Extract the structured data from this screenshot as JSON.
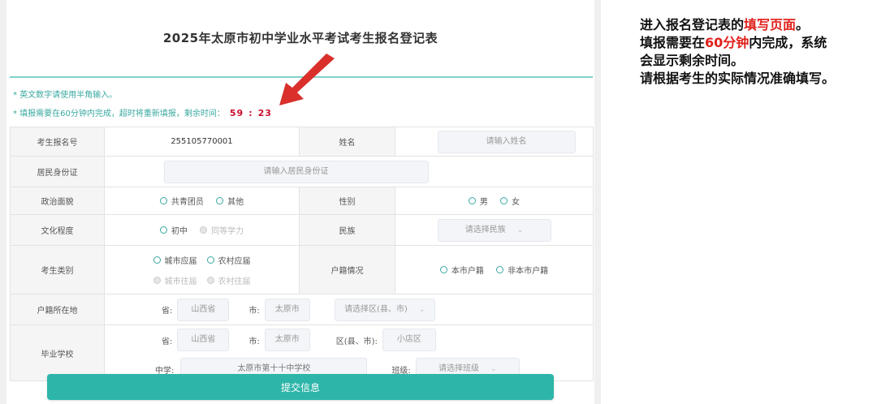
{
  "form": {
    "title": "2025年太原市初中学业水平考试考生报名登记表",
    "note1": "* 英文数字请使用半角输入。",
    "note2": "* 填报需要在60分钟内完成，超时将重新填报，剩余时间：",
    "timer_min": "59",
    "timer_sep": ":",
    "timer_sec": "23",
    "rows": {
      "reg_no_label": "考生报名号",
      "reg_no_value": "255105770001",
      "name_label": "姓名",
      "name_placeholder": "请输入姓名",
      "id_label": "居民身份证",
      "id_placeholder": "请输入居民身份证",
      "politics_label": "政治面貌",
      "politics_opt1": "共青团员",
      "politics_opt2": "其他",
      "gender_label": "性别",
      "gender_opt1": "男",
      "gender_opt2": "女",
      "edu_label": "文化程度",
      "edu_opt1": "初中",
      "edu_opt2": "同等学力",
      "ethnic_label": "民族",
      "ethnic_placeholder": "请选择民族",
      "type_label": "考生类别",
      "type_opt1": "城市应届",
      "type_opt2": "农村应届",
      "type_opt3": "城市往届",
      "type_opt4": "农村往届",
      "hukou_label": "户籍情况",
      "hukou_opt1": "本市户籍",
      "hukou_opt2": "非本市户籍",
      "hukou_loc_label": "户籍所在地",
      "province_label": "省:",
      "province_value": "山西省",
      "city_label": "市:",
      "city_value": "太原市",
      "district_placeholder": "请选择区(县、市)",
      "school_label": "毕业学校",
      "school_province_label": "省:",
      "school_province_value": "山西省",
      "school_city_label": "市:",
      "school_city_value": "太原市",
      "school_district_label": "区(县、市):",
      "school_district_value": "小店区",
      "middle_school_label": "中学:",
      "middle_school_value": "太原市第十十中学校",
      "class_label": "班级:",
      "class_placeholder": "请选择班级"
    },
    "submit_label": "提交信息"
  },
  "side": {
    "line1_prefix": "进入报名登记表的",
    "line1_highlight": "填写页面",
    "line1_suffix": "。",
    "line2_prefix": "填报需要在",
    "line2_highlight": "60分钟",
    "line2_suffix": "内完成，系统",
    "line3": "会显示剩余时间。",
    "line4": "请根据考生的实际情况准确填写。"
  },
  "colors": {
    "accent": "#2db5a9",
    "timer": "#c8102e",
    "highlight": "#e0201b",
    "arrow": "#d9302c"
  }
}
